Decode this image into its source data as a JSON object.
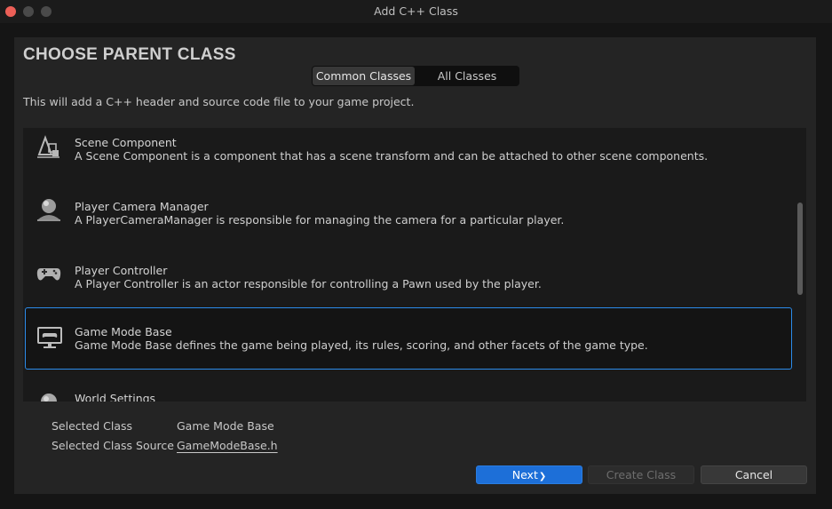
{
  "window": {
    "title": "Add C++ Class"
  },
  "heading": "CHOOSE PARENT CLASS",
  "tabs": [
    {
      "label": "Common Classes",
      "active": true
    },
    {
      "label": "All Classes",
      "active": false
    }
  ],
  "description": "This will add a C++ header and source code file to your game project.",
  "class_list": {
    "items": [
      {
        "name": "Scene Component",
        "description": "A Scene Component is a component that has a scene transform and can be attached to other scene components.",
        "icon": "scene-component-icon",
        "selected": false
      },
      {
        "name": "Player Camera Manager",
        "description": "A PlayerCameraManager is responsible for managing the camera for a particular player.",
        "icon": "camera-manager-icon",
        "selected": false
      },
      {
        "name": "Player Controller",
        "description": "A Player Controller is an actor responsible for controlling a Pawn used by the player.",
        "icon": "gamepad-icon",
        "selected": false
      },
      {
        "name": "Game Mode Base",
        "description": "Game Mode Base defines the game being played, its rules, scoring, and other facets of the game type.",
        "icon": "game-mode-icon",
        "selected": true
      },
      {
        "name": "World Settings",
        "description": "",
        "icon": "world-settings-icon",
        "selected": false
      }
    ]
  },
  "selection": {
    "class_label": "Selected Class",
    "class_value": "Game Mode Base",
    "source_label": "Selected Class Source",
    "source_value": "GameModeBase.h"
  },
  "buttons": {
    "next": "Next",
    "next_glyph": "❯",
    "create": "Create Class",
    "cancel": "Cancel"
  },
  "colors": {
    "accent": "#1d6fd8",
    "selection_border": "#2b8bea",
    "close_button": "#ec5f57"
  }
}
